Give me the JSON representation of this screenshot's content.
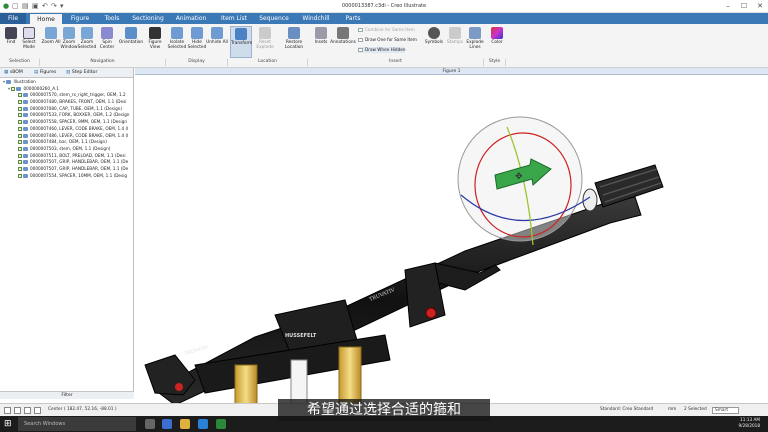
{
  "window": {
    "title": "0000013387.c3di - Creo Illustrate"
  },
  "tabs": [
    "File",
    "Home",
    "Figure",
    "Tools",
    "Sectioning",
    "Animation",
    "Item List",
    "Sequence",
    "Windchill",
    "Parts"
  ],
  "ribbon": {
    "buttons": {
      "find": "Find",
      "select_mode": "Select Mode",
      "zoom_all": "Zoom All",
      "zoom_window": "Zoom Window",
      "zoom_selected": "Zoom Selected",
      "spin_center": "Spin Center",
      "orientation": "Orientation",
      "figure_view": "Figure View",
      "isolate_selected": "Isolate Selected",
      "hide_selected": "Hide Selected",
      "unhide_all": "Unhide All",
      "transform": "Transform",
      "reset_explode": "Reset Explode",
      "restore_location": "Restore Location",
      "insets": "Insets",
      "annotations": "Annotations",
      "symbols": "Symbols",
      "stamps": "Stamps",
      "explode_lines": "Explode Lines",
      "color": "Color"
    },
    "insert_small": [
      "Combine for Same Item",
      "Draw One for Same Item",
      "Draw When Hidden"
    ],
    "groups": {
      "selection": "Selection",
      "navigation": "Navigation",
      "display": "Display",
      "location": "Location",
      "insert": "Insert",
      "style": "Style"
    }
  },
  "panel": {
    "tabs": [
      "sBOM",
      "Figures",
      "Step Editor"
    ],
    "tree_root": "Illustration",
    "tree_assembly": "0000000260_A.1",
    "tree_items": [
      "0000007570, stem_rx_right_trigger, OEM, 1.2",
      "0000007480, BRAKES, FRONT, OEM, 1.1 (Desi",
      "0000007080, CAP, TUBE, OEM, 1.1 (Design)",
      "0000007533, FORK, BOXXER, OEM, 1.2 (Design",
      "0000007558, SPACER, 9MM, OEM, 1.1 (Design",
      "0000007460, LEVER, CODE BRAKE, OEM, 1.4 (I",
      "0000007486, LEVER, CODE BRAKE, OEM, 1.4 (I",
      "0000007484, bar, OEM, 1.1 (Design)",
      "0000007503, stem, OEM, 1.1 (Design)",
      "0000007511, BOLT, PRELOAD, OEM, 1.1 (Desi",
      "0000007507, GRIP, HANDLEBAR, OEM, 1.1 (De",
      "0000007507, GRIP, HANDLEBAR, OEM, 1.1 (De",
      "0000007554, SPACER, 10MM, OEM, 1.1 (Desig"
    ],
    "filter": "Filter"
  },
  "viewport": {
    "title": "Figure 1",
    "brand_top": "TRUVATIV",
    "brand_center": "HUSSEFELT",
    "brand_left": "TRUVATIV"
  },
  "status": {
    "center": "Center ( 182.47, 52.16, -88.01 )",
    "standard": "Standard: Creo Standard",
    "unit": "mm",
    "selected": "2 Selected",
    "mode": "Smart"
  },
  "taskbar": {
    "search": "Search Windows",
    "time": "11:13 AM",
    "date": "9/28/2018"
  },
  "subtitle": "希望通过选择合适的箍和",
  "colors": {
    "accent": "#3a78b6",
    "grip": "#2a2a2a",
    "fork": "#e5c86b",
    "dragger_arrow": "#3aa64a"
  }
}
